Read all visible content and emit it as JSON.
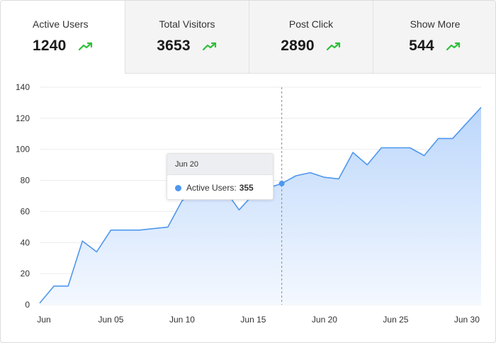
{
  "tabs": [
    {
      "label": "Active Users",
      "value": "1240",
      "icon": "trend-up-icon",
      "active": true
    },
    {
      "label": "Total Visitors",
      "value": "3653",
      "icon": "trend-up-icon",
      "active": false
    },
    {
      "label": "Post Click",
      "value": "2890",
      "icon": "trend-up-icon",
      "active": false
    },
    {
      "label": "Show More",
      "value": "544",
      "icon": "trend-up-icon",
      "active": false
    }
  ],
  "colors": {
    "trend": "#2fbf3a",
    "line": "#4e97ee",
    "area_top": "#bcd7fb",
    "area_bottom": "#f4f8ff"
  },
  "tooltip": {
    "date": "Jun 20",
    "series": "Active Users:",
    "value": "355"
  },
  "chart_data": {
    "type": "area",
    "x_tick_labels": [
      "Jun",
      "Jun 05",
      "Jun 10",
      "Jun 15",
      "Jun 20",
      "Jun 25",
      "Jun 30"
    ],
    "y_ticks": [
      0,
      20,
      40,
      60,
      80,
      100,
      120,
      140
    ],
    "ylim": [
      0,
      140
    ],
    "xlim": [
      1,
      32
    ],
    "x": [
      1,
      2,
      3,
      4,
      5,
      6,
      7,
      8,
      9,
      10,
      11,
      12,
      13,
      14,
      15,
      16,
      17,
      18,
      19,
      20,
      21,
      22,
      23,
      24,
      25,
      26,
      27,
      28,
      29,
      30,
      31,
      32
    ],
    "values": [
      1,
      12,
      12,
      41,
      34,
      48,
      48,
      48,
      49,
      50,
      67,
      73,
      68,
      74,
      61,
      71,
      75,
      78,
      83,
      85,
      82,
      81,
      98,
      90,
      101,
      101,
      101,
      96,
      107,
      107,
      117,
      127
    ],
    "grid": true,
    "highlight_x": 18
  }
}
